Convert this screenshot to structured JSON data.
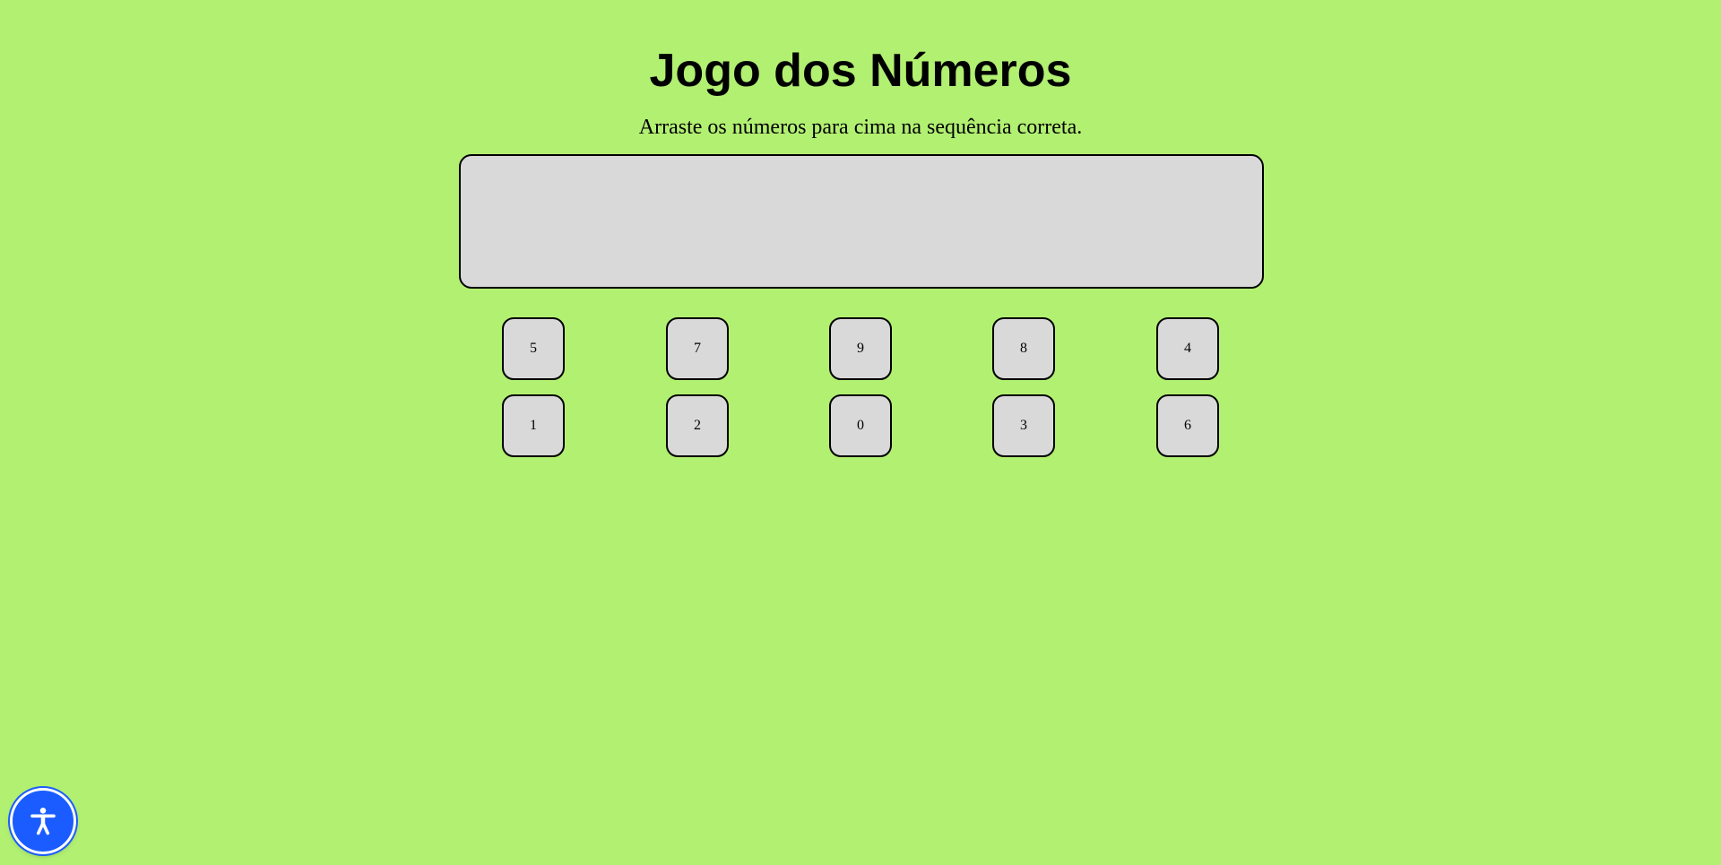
{
  "game": {
    "title": "Jogo dos Números",
    "instructions": "Arraste os números para cima na sequência correta."
  },
  "tiles": {
    "row1": [
      "5",
      "7",
      "9",
      "8",
      "4"
    ],
    "row2": [
      "1",
      "2",
      "0",
      "3",
      "6"
    ]
  },
  "accessibility": {
    "icon": "accessibility-icon",
    "color": "#1a5cff"
  },
  "colors": {
    "background": "#b2f072",
    "tile": "#d9d9d9",
    "border": "#000000"
  }
}
